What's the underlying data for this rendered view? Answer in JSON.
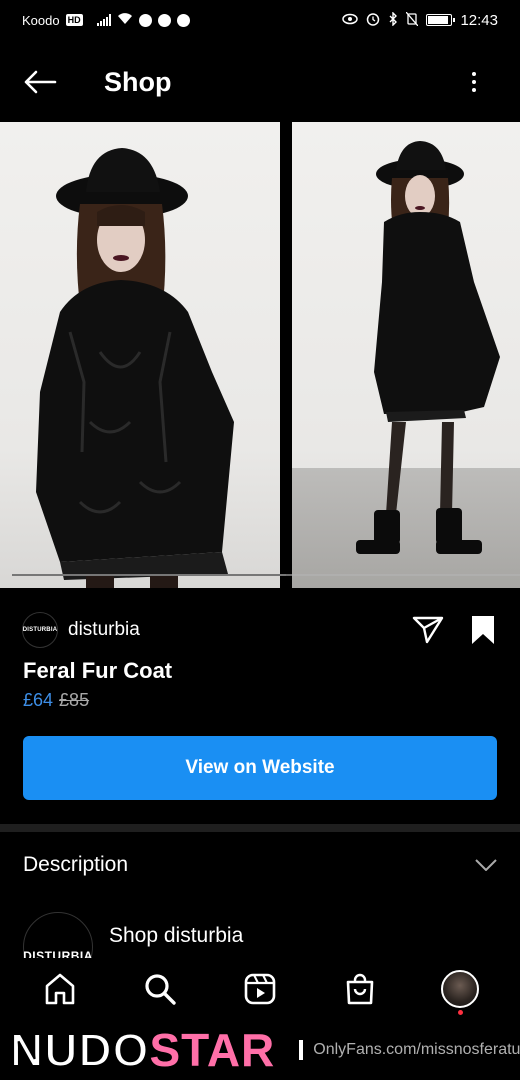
{
  "status_bar": {
    "carrier": "Koodo",
    "network_badge": "HD",
    "time": "12:43"
  },
  "header": {
    "title": "Shop"
  },
  "gallery": {
    "image_count": 2,
    "scroll_progress": 0.54
  },
  "seller": {
    "avatar_text": "DISTURBIA",
    "name": "disturbia"
  },
  "product": {
    "title": "Feral Fur Coat",
    "price_sale": "£64",
    "price_original": "£85"
  },
  "cta": {
    "label": "View on Website",
    "color": "#1a8ff3"
  },
  "description": {
    "label": "Description"
  },
  "shop_link": {
    "avatar_text": "DISTURBIA",
    "label": "Shop disturbia"
  },
  "bottom_nav": {
    "items": [
      "home-icon",
      "search-icon",
      "reels-icon",
      "shop-icon",
      "profile-avatar"
    ],
    "notification_color": "#ff3040"
  },
  "watermark": {
    "brand_part1": "NUDO",
    "brand_part2": "STAR",
    "url": "OnlyFans.com/missnosferatu"
  }
}
